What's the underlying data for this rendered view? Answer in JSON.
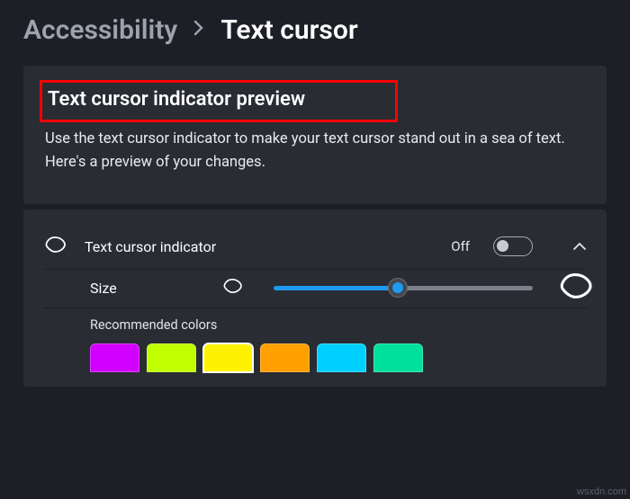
{
  "breadcrumb": {
    "parent": "Accessibility",
    "leaf": "Text cursor"
  },
  "preview": {
    "title": "Text cursor indicator preview",
    "desc": "Use the text cursor indicator to make your text cursor stand out in a sea of text. Here's a preview of your changes."
  },
  "toggleRow": {
    "label": "Text cursor indicator",
    "status": "Off"
  },
  "sizeRow": {
    "label": "Size",
    "value_pct": 48
  },
  "colorsRow": {
    "label": "Recommended colors",
    "swatches": [
      {
        "hex": "#d100ff",
        "selected": false
      },
      {
        "hex": "#bfff00",
        "selected": false
      },
      {
        "hex": "#fff200",
        "selected": true
      },
      {
        "hex": "#ff9f00",
        "selected": false
      },
      {
        "hex": "#00d0ff",
        "selected": false
      },
      {
        "hex": "#00e09a",
        "selected": false
      }
    ]
  },
  "watermark": "wsxdn.com"
}
